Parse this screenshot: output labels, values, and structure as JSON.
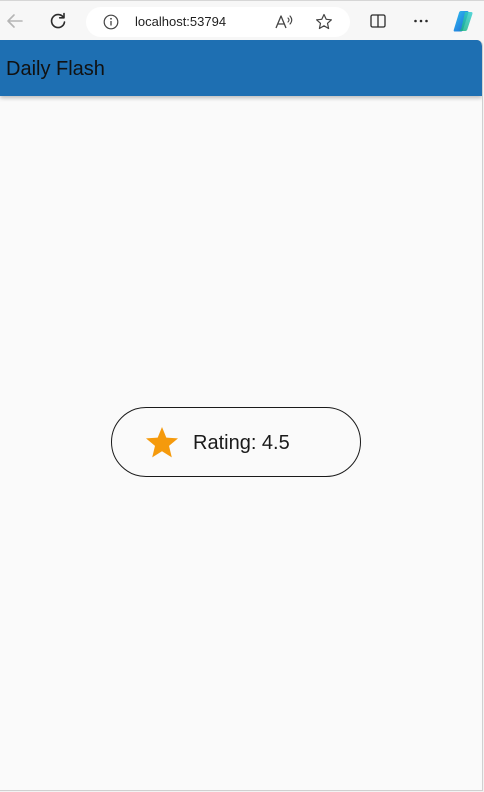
{
  "browser": {
    "address_url": "localhost:53794",
    "read_aloud_label": "A",
    "icons": {
      "back": "back-arrow-icon",
      "refresh": "refresh-icon",
      "info": "info-icon",
      "read_aloud": "read-aloud-icon",
      "favorite": "favorite-star-icon",
      "split_screen": "split-screen-icon",
      "more": "more-icon",
      "copilot": "copilot-icon"
    }
  },
  "app": {
    "title": "Daily Flash",
    "appbar_color": "#1e6fb2",
    "rating": {
      "text": "Rating: 4.5",
      "value": 4.5,
      "icon": "star-icon",
      "star_color": "#f59a0c"
    }
  }
}
